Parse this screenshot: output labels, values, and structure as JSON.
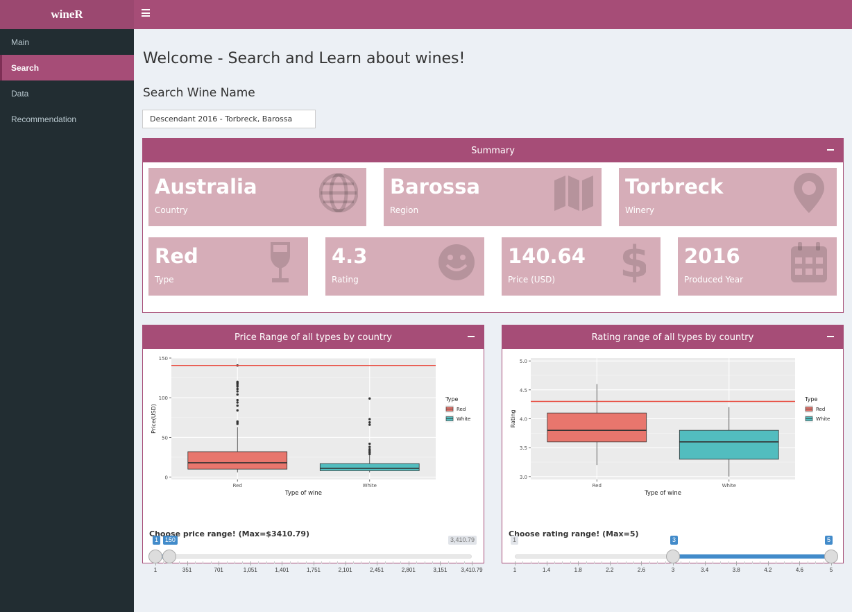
{
  "app": {
    "title": "wineR"
  },
  "sidebar": {
    "items": [
      {
        "label": "Main",
        "active": false
      },
      {
        "label": "Search",
        "active": true
      },
      {
        "label": "Data",
        "active": false
      },
      {
        "label": "Recommendation",
        "active": false
      }
    ]
  },
  "colors": {
    "accent": "#a64d77",
    "sidebar": "#222d32",
    "valuebox": "#d6adb8",
    "red_series": "#e8766d",
    "white_series": "#52bdbf",
    "ref_line": "#e8473b"
  },
  "page": {
    "title": "Welcome - Search and Learn about wines!",
    "search_label": "Search Wine Name",
    "search_value": "Descendant 2016 - Torbreck, Barossa"
  },
  "summary": {
    "title": "Summary",
    "boxes": [
      {
        "value": "Australia",
        "label": "Country",
        "icon": "globe-icon"
      },
      {
        "value": "Barossa",
        "label": "Region",
        "icon": "map-icon"
      },
      {
        "value": "Torbreck",
        "label": "Winery",
        "icon": "map-marker-icon"
      },
      {
        "value": "Red",
        "label": "Type",
        "icon": "wine-glass-icon"
      },
      {
        "value": "4.3",
        "label": "Rating",
        "icon": "smile-icon"
      },
      {
        "value": "140.64",
        "label": "Price (USD)",
        "icon": "dollar-icon"
      },
      {
        "value": "2016",
        "label": "Produced Year",
        "icon": "calendar-icon"
      }
    ]
  },
  "price_panel": {
    "title": "Price Range of all types by country",
    "slider_label": "Choose price range! (Max=$3410.79)",
    "slider": {
      "min": 1,
      "max": 3410.79,
      "from": 1,
      "to": 150,
      "from_label": "1",
      "to_label": "150",
      "max_label": "3,410.79",
      "ticks": [
        "1",
        "351",
        "701",
        "1,051",
        "1,401",
        "1,751",
        "2,101",
        "2,451",
        "2,801",
        "3,151",
        "3,410.79"
      ]
    }
  },
  "rating_panel": {
    "title": "Rating range of all types by country",
    "slider_label": "Choose rating range! (Max=5)",
    "slider": {
      "min": 1,
      "max": 5,
      "from": 3,
      "to": 5,
      "from_label": "3",
      "to_label": "5",
      "min_label": "1",
      "ticks": [
        "1",
        "1.4",
        "1.8",
        "2.2",
        "2.6",
        "3",
        "3.4",
        "3.8",
        "4.2",
        "4.6",
        "5"
      ]
    }
  },
  "chart_data": [
    {
      "type": "boxplot",
      "xlabel": "Type of wine",
      "ylabel": "Price(USD)",
      "ylim": [
        -3,
        150
      ],
      "yticks": [
        0,
        50,
        100,
        150
      ],
      "ytick_labels": [
        "0",
        "50",
        "100",
        "150"
      ],
      "categories": [
        "Red",
        "White"
      ],
      "legend": {
        "title": "Type",
        "entries": [
          "Red",
          "White"
        ],
        "position": "right"
      },
      "reference_line": 140.64,
      "series": [
        {
          "name": "Red",
          "whisker_low": 6,
          "q1": 10,
          "median": 18,
          "q3": 32,
          "whisker_high": 63,
          "outliers": [
            67,
            69,
            70,
            84,
            90,
            94,
            97,
            104,
            108,
            111,
            114,
            116,
            118,
            119,
            120,
            140.64
          ]
        },
        {
          "name": "White",
          "whisker_low": 6,
          "q1": 8,
          "median": 11,
          "q3": 17,
          "whisker_high": 28,
          "outliers": [
            29,
            31,
            33,
            35,
            38,
            42,
            66,
            69,
            73,
            99
          ]
        }
      ]
    },
    {
      "type": "boxplot",
      "xlabel": "Type of wine",
      "ylabel": "Rating",
      "ylim": [
        2.95,
        5.05
      ],
      "yticks": [
        3.0,
        3.5,
        4.0,
        4.5,
        5.0
      ],
      "ytick_labels": [
        "3.0",
        "3.5",
        "4.0",
        "4.5",
        "5.0"
      ],
      "categories": [
        "Red",
        "White"
      ],
      "legend": {
        "title": "Type",
        "entries": [
          "Red",
          "White"
        ],
        "position": "right"
      },
      "reference_line": 4.3,
      "series": [
        {
          "name": "Red",
          "whisker_low": 3.2,
          "q1": 3.6,
          "median": 3.8,
          "q3": 4.1,
          "whisker_high": 4.6,
          "outliers": []
        },
        {
          "name": "White",
          "whisker_low": 3.0,
          "q1": 3.3,
          "median": 3.6,
          "q3": 3.8,
          "whisker_high": 4.2,
          "outliers": []
        }
      ]
    }
  ]
}
